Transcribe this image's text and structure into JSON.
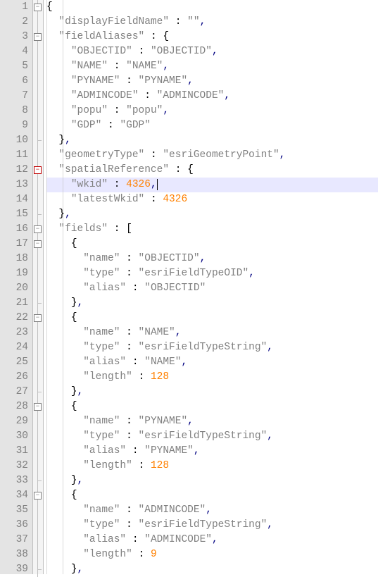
{
  "lines": [
    "1",
    "2",
    "3",
    "4",
    "5",
    "6",
    "7",
    "8",
    "9",
    "10",
    "11",
    "12",
    "13",
    "14",
    "15",
    "16",
    "17",
    "18",
    "19",
    "20",
    "21",
    "22",
    "23",
    "24",
    "25",
    "26",
    "27",
    "28",
    "29",
    "30",
    "31",
    "32",
    "33",
    "34",
    "35",
    "36",
    "37",
    "38",
    "39"
  ],
  "json": {
    "displayFieldName": "",
    "fieldAliases": {
      "OBJECTID": "OBJECTID",
      "NAME": "NAME",
      "PYNAME": "PYNAME",
      "ADMINCODE": "ADMINCODE",
      "popu": "popu",
      "GDP": "GDP"
    },
    "geometryType": "esriGeometryPoint",
    "spatialReference": {
      "wkid": 4326,
      "latestWkid": 4326
    },
    "fields": [
      {
        "name": "OBJECTID",
        "type": "esriFieldTypeOID",
        "alias": "OBJECTID"
      },
      {
        "name": "NAME",
        "type": "esriFieldTypeString",
        "alias": "NAME",
        "length": 128
      },
      {
        "name": "PYNAME",
        "type": "esriFieldTypeString",
        "alias": "PYNAME",
        "length": 128
      },
      {
        "name": "ADMINCODE",
        "type": "esriFieldTypeString",
        "alias": "ADMINCODE",
        "length": 9
      }
    ]
  },
  "highlight_line": 13,
  "tokens": {
    "brace_open": "{",
    "brace_close": "}",
    "bracket_open": "[",
    "bracket_close": "]",
    "quote": "\"",
    "colon": ":",
    "comma": ",",
    "k_displayFieldName": "displayFieldName",
    "k_fieldAliases": "fieldAliases",
    "k_OBJECTID": "OBJECTID",
    "k_NAME": "NAME",
    "k_PYNAME": "PYNAME",
    "k_ADMINCODE": "ADMINCODE",
    "k_popu": "popu",
    "k_GDP": "GDP",
    "k_geometryType": "geometryType",
    "v_geometryType": "esriGeometryPoint",
    "k_spatialReference": "spatialReference",
    "k_wkid": "wkid",
    "v_wkid": "4326",
    "k_latestWkid": "latestWkid",
    "v_latestWkid": "4326",
    "k_fields": "fields",
    "k_name": "name",
    "k_type": "type",
    "k_alias": "alias",
    "k_length": "length",
    "v_typeOID": "esriFieldTypeOID",
    "v_typeString": "esriFieldTypeString",
    "v_len128": "128",
    "v_len9": "9",
    "empty": ""
  },
  "fold": [
    "box",
    "",
    "box",
    "",
    "",
    "",
    "",
    "",
    "",
    "corner",
    "",
    "box",
    "",
    "",
    "corner",
    "box",
    "box",
    "",
    "",
    "",
    "corner",
    "box",
    "",
    "",
    "",
    "",
    "corner",
    "box",
    "",
    "",
    "",
    "",
    "corner",
    "box",
    "",
    "",
    "",
    "",
    "corner"
  ],
  "fold_box_red_line": 12
}
